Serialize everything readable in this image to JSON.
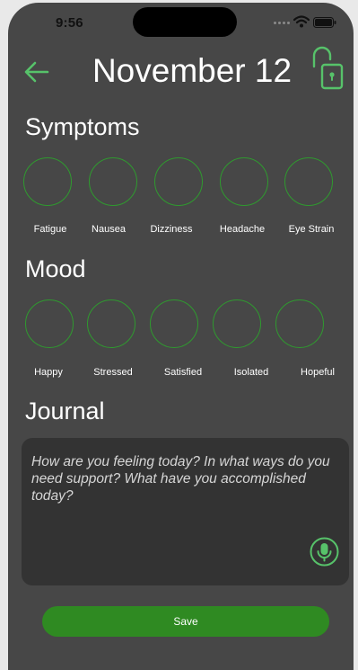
{
  "status_bar": {
    "time": "9:56"
  },
  "header": {
    "title": "November 12"
  },
  "symptoms": {
    "title": "Symptoms",
    "items": [
      "Fatigue",
      "Nausea",
      "Dizziness",
      "Headache",
      "Eye Strain"
    ]
  },
  "mood": {
    "title": "Mood",
    "items": [
      "Happy",
      "Stressed",
      "Satisfied",
      "Isolated",
      "Hopeful"
    ]
  },
  "journal": {
    "title": "Journal",
    "placeholder": "How are you feeling today? In what ways do you need support? What have you accomplished today?"
  },
  "save_label": "Save",
  "colors": {
    "accent": "#2f9a2f",
    "button": "#2f8a22",
    "background": "#474747",
    "journal_bg": "#333333"
  },
  "icons": [
    "back-arrow-icon",
    "unlocked-padlock-icon",
    "microphone-icon",
    "wifi-icon",
    "battery-icon"
  ]
}
